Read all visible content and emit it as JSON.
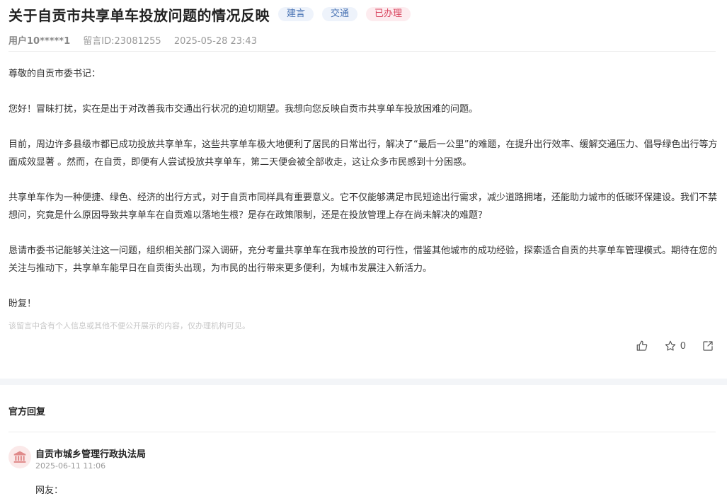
{
  "post": {
    "title": "关于自贡市共享单车投放问题的情况反映",
    "tags": [
      "建言",
      "交通"
    ],
    "status": "已办理",
    "author": "用户10*****1",
    "message_id": "留言ID:23081255",
    "datetime": "2025-05-28 23:43",
    "paragraphs": [
      "尊敬的自贡市委书记：",
      "您好！冒昧打扰，实在是出于对改善我市交通出行状况的迫切期望。我想向您反映自贡市共享单车投放困难的问题。",
      "目前，周边许多县级市都已成功投放共享单车，这些共享单车极大地便利了居民的日常出行，解决了“最后一公里”的难题，在提升出行效率、缓解交通压力、倡导绿色出行等方面成效显著 。然而，在自贡，即便有人尝试投放共享单车，第二天便会被全部收走，这让众多市民感到十分困惑。",
      "共享单车作为一种便捷、绿色、经济的出行方式，对于自贡市同样具有重要意义。它不仅能够满足市民短途出行需求，减少道路拥堵，还能助力城市的低碳环保建设。我们不禁想问，究竟是什么原因导致共享单车在自贡难以落地生根？是存在政策限制，还是在投放管理上存在尚未解决的难题？",
      "恳请市委书记能够关注这一问题，组织相关部门深入调研，充分考量共享单车在我市投放的可行性，借鉴其他城市的成功经验，探索适合自贡的共享单车管理模式。期待在您的关注与推动下，共享单车能早日在自贡街头出现，为市民的出行带来更多便利，为城市发展注入新活力。",
      "盼复！"
    ],
    "privacy_notice": "该留言中含有个人信息或其他不便公开展示的内容，仅办理机构可见。",
    "favorite_count": "0"
  },
  "reply": {
    "section_title": "官方回复",
    "org_name": "自贡市城乡管理行政执法局",
    "datetime": "2025-06-11 11:06",
    "greeting": "网友："
  },
  "icons": {
    "like": "thumbs-up-icon",
    "favorite": "star-icon",
    "share": "share-icon",
    "org": "government-building-icon"
  },
  "colors": {
    "status_tag_text": "#d9455f",
    "category_tag_text": "#4a74b4",
    "org_avatar_bg": "#fbe9e9",
    "org_avatar_icon": "#e08a8a"
  }
}
